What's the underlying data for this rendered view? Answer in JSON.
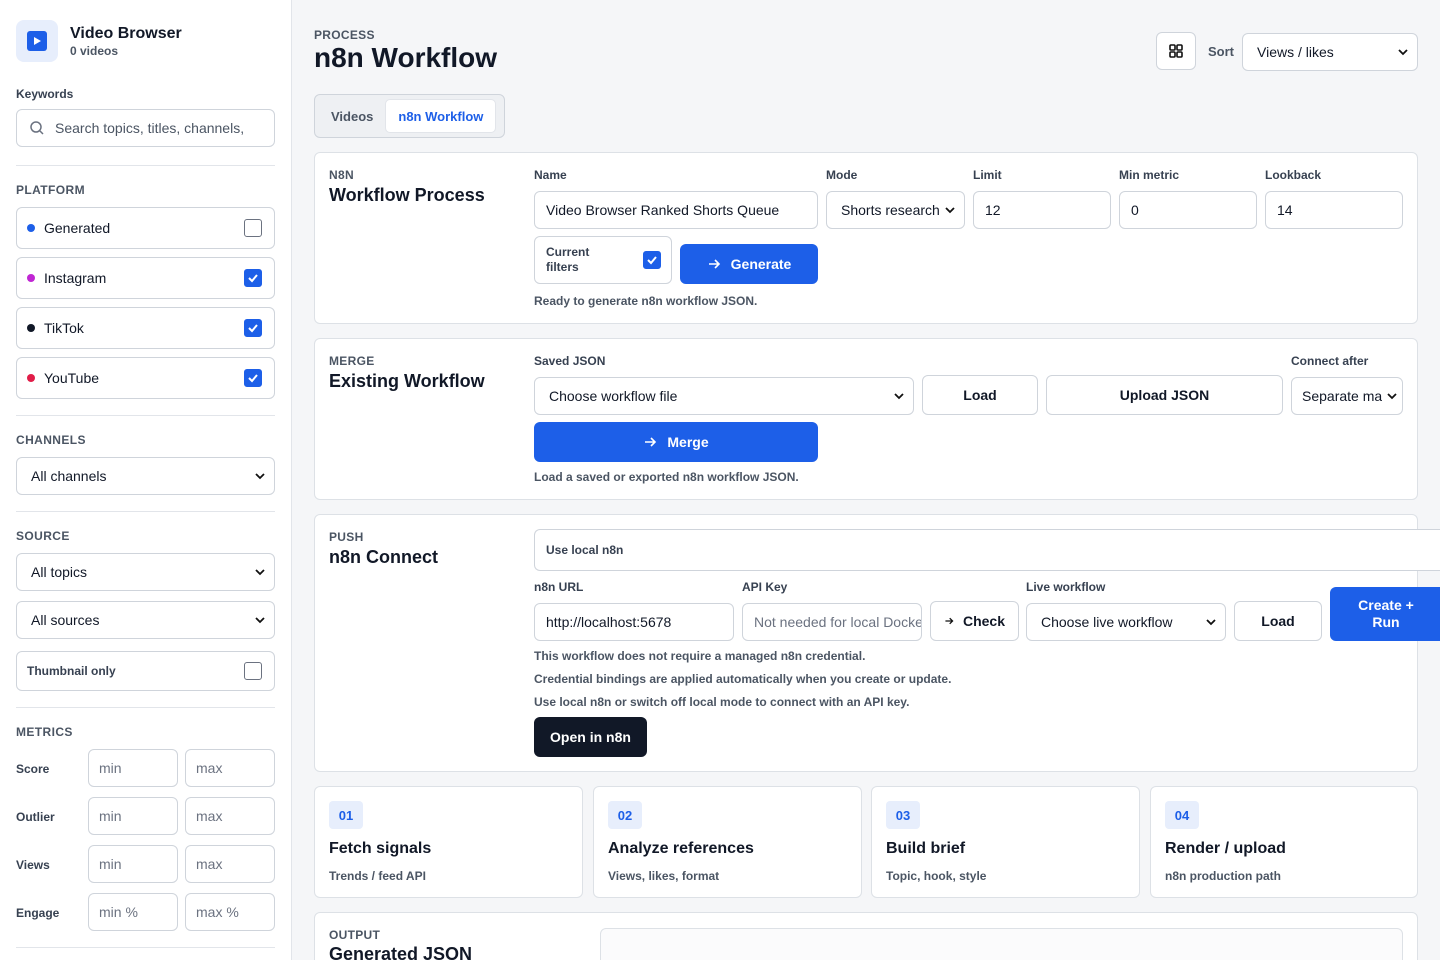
{
  "app": {
    "title": "Video Browser",
    "count": "0 videos"
  },
  "sidebar": {
    "keywords_label": "Keywords",
    "search_placeholder": "Search topics, titles, channels,",
    "platform_label": "PLATFORM",
    "platforms": [
      {
        "label": "Generated",
        "checked": false,
        "color": "#1d5fe8"
      },
      {
        "label": "Instagram",
        "checked": true,
        "color": "#c026d3"
      },
      {
        "label": "TikTok",
        "checked": true,
        "color": "#111827"
      },
      {
        "label": "YouTube",
        "checked": true,
        "color": "#e11d48"
      }
    ],
    "channels_label": "CHANNELS",
    "channels_value": "All channels",
    "source_label": "SOURCE",
    "topics_value": "All topics",
    "sources_value": "All sources",
    "thumbnail_label": "Thumbnail only",
    "thumbnail_checked": false,
    "metrics_label": "METRICS",
    "metrics": [
      {
        "label": "Score",
        "min": "min",
        "max": "max"
      },
      {
        "label": "Outlier",
        "min": "min",
        "max": "max"
      },
      {
        "label": "Views",
        "min": "min",
        "max": "max"
      },
      {
        "label": "Engage",
        "min": "min %",
        "max": "max %"
      }
    ]
  },
  "header": {
    "eyebrow": "PROCESS",
    "title": "n8n Workflow",
    "sort_label": "Sort",
    "sort_value": "Views / likes",
    "tabs": [
      "Videos",
      "n8n Workflow"
    ]
  },
  "process": {
    "eyebrow": "N8N",
    "title": "Workflow Process",
    "name_label": "Name",
    "name_value": "Video Browser Ranked Shorts Queue",
    "mode_label": "Mode",
    "mode_value": "Shorts research",
    "limit_label": "Limit",
    "limit_value": "12",
    "minmetric_label": "Min metric",
    "minmetric_value": "0",
    "lookback_label": "Lookback",
    "lookback_value": "14",
    "current_filters_label": "Current filters",
    "current_filters_checked": true,
    "generate_label": "Generate",
    "status": "Ready to generate n8n workflow JSON."
  },
  "merge": {
    "eyebrow": "MERGE",
    "title": "Existing Workflow",
    "saved_label": "Saved JSON",
    "saved_value": "Choose workflow file",
    "load_label": "Load",
    "upload_label": "Upload JSON",
    "connect_label": "Connect after",
    "connect_value": "Separate manual",
    "merge_label": "Merge",
    "status": "Load a saved or exported n8n workflow JSON."
  },
  "push": {
    "eyebrow": "PUSH",
    "title": "n8n Connect",
    "use_local_label": "Use local n8n",
    "url_label": "n8n URL",
    "url_value": "http://localhost:5678",
    "apikey_label": "API Key",
    "apikey_placeholder": "Not needed for local Docker",
    "check_label": "Check",
    "live_label": "Live workflow",
    "live_value": "Choose live workflow",
    "load_label": "Load",
    "create_label": "Create + Run",
    "notes": [
      "This workflow does not require a managed n8n credential.",
      "Credential bindings are applied automatically when you create or update.",
      "Use local n8n or switch off local mode to connect with an API key."
    ],
    "open_label": "Open in n8n"
  },
  "steps": [
    {
      "num": "01",
      "title": "Fetch signals",
      "sub": "Trends / feed API"
    },
    {
      "num": "02",
      "title": "Analyze references",
      "sub": "Views, likes, format"
    },
    {
      "num": "03",
      "title": "Build brief",
      "sub": "Topic, hook, style"
    },
    {
      "num": "04",
      "title": "Render / upload",
      "sub": "n8n production path"
    }
  ],
  "output": {
    "eyebrow": "OUTPUT",
    "title": "Generated JSON"
  },
  "colors": {
    "accent": "#1d5fe8",
    "dark_button": "#111827"
  }
}
